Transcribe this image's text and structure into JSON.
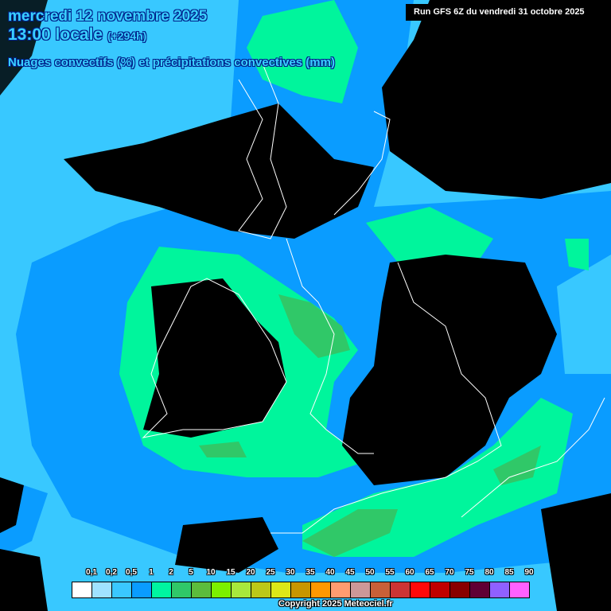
{
  "header": {
    "date": "mercredi 12 novembre 2025",
    "time": "13:00 locale",
    "lead": "(+294h)",
    "subtitle": "Nuages convectifs (%) et précipitations convectives (mm)",
    "run": "Run GFS 6Z du vendredi 31 octobre 2025"
  },
  "legend": {
    "labels": [
      "0,1",
      "0,2",
      "0,5",
      "1",
      "2",
      "5",
      "10",
      "15",
      "20",
      "25",
      "30",
      "35",
      "40",
      "45",
      "50",
      "55",
      "60",
      "65",
      "70",
      "75",
      "80",
      "85",
      "90"
    ],
    "colors": [
      "#ffffff",
      "#a0e2ff",
      "#3ac8ff",
      "#0a9cff",
      "#00f5a0",
      "#30c868",
      "#5cbc3c",
      "#7cf000",
      "#a8e83c",
      "#bcc818",
      "#dce818",
      "#c89600",
      "#ff9800",
      "#ff9c70",
      "#cc9898",
      "#c86038",
      "#cc3434",
      "#ff0a0a",
      "#c00000",
      "#880000",
      "#600034",
      "#9060ff",
      "#ff60ff"
    ]
  },
  "copyright": "Copyright 2025 Meteociel.fr",
  "map_colors": {
    "sky": "#38c8ff",
    "blue": "#0a9cff",
    "green": "#00f59c",
    "dkgreen": "#30c868",
    "cloud": "#000000"
  }
}
